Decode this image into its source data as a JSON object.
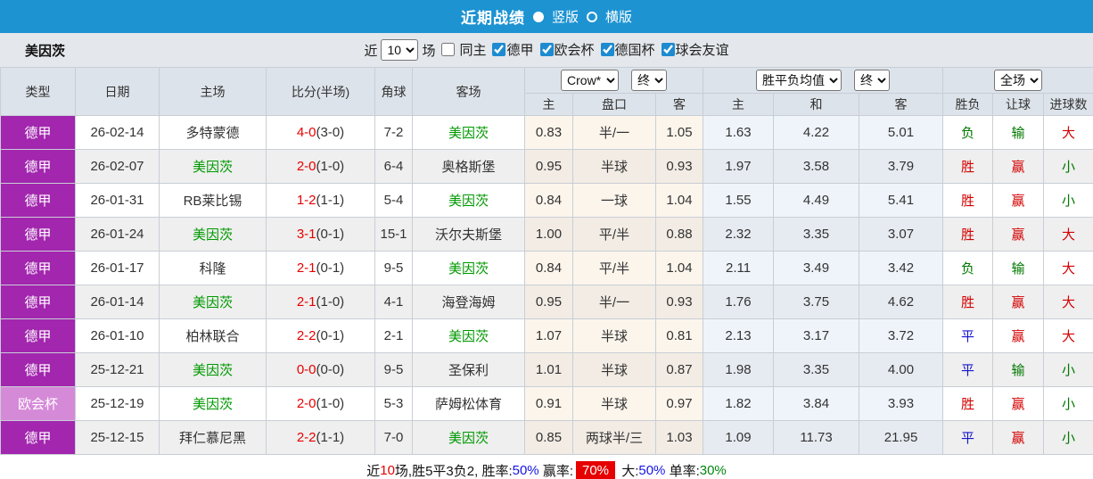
{
  "top_bar": {
    "title": "近期战绩",
    "layout_options": [
      {
        "label": "竖版",
        "selected": true
      },
      {
        "label": "横版",
        "selected": false
      }
    ]
  },
  "filter_bar": {
    "team": "美因茨",
    "recent_prefix": "近",
    "recent_count": "10",
    "recent_suffix": "场",
    "checkboxes": [
      {
        "label": "同主",
        "checked": false
      },
      {
        "label": "德甲",
        "checked": true
      },
      {
        "label": "欧会杯",
        "checked": true
      },
      {
        "label": "德国杯",
        "checked": true
      },
      {
        "label": "球会友谊",
        "checked": true
      }
    ]
  },
  "colors": {
    "topbar_blue": "#1d93d2",
    "league_purple": "#a226ae",
    "cup_purple": "#d58ad8",
    "focus_team_green": "#009900",
    "score_red": "#e80000",
    "win_red": "#d40000",
    "lose_green": "#007700",
    "draw_blue": "#1515cc"
  },
  "table": {
    "headers": {
      "type": "类型",
      "date": "日期",
      "home": "主场",
      "score": "比分(半场)",
      "corner": "角球",
      "away": "客场",
      "odds_sub": [
        "主",
        "盘口",
        "客"
      ],
      "avg_sub": [
        "主",
        "和",
        "客"
      ],
      "result_sub": [
        "胜负",
        "让球",
        "进球数"
      ]
    },
    "selects": {
      "bookmaker": "Crow*",
      "odds_time": "终",
      "avg_label": "胜平负均值",
      "avg_time": "终",
      "scope": "全场"
    },
    "rows": [
      {
        "type": {
          "label": "德甲",
          "variant": "dark"
        },
        "date": "26-02-14",
        "home": {
          "name": "多特蒙德",
          "focus": false
        },
        "score": {
          "full": "4-0",
          "half": "(3-0)"
        },
        "corner": "7-2",
        "away": {
          "name": "美因茨",
          "focus": true
        },
        "odds": [
          "0.83",
          "半/一",
          "1.05"
        ],
        "avg": [
          "1.63",
          "4.22",
          "5.01"
        ],
        "outcome": [
          {
            "t": "负",
            "c": "green"
          },
          {
            "t": "输",
            "c": "green"
          },
          {
            "t": "大",
            "c": "red"
          }
        ]
      },
      {
        "type": {
          "label": "德甲",
          "variant": "dark"
        },
        "date": "26-02-07",
        "home": {
          "name": "美因茨",
          "focus": true
        },
        "score": {
          "full": "2-0",
          "half": "(1-0)"
        },
        "corner": "6-4",
        "away": {
          "name": "奥格斯堡",
          "focus": false
        },
        "odds": [
          "0.95",
          "半球",
          "0.93"
        ],
        "avg": [
          "1.97",
          "3.58",
          "3.79"
        ],
        "outcome": [
          {
            "t": "胜",
            "c": "red"
          },
          {
            "t": "赢",
            "c": "red"
          },
          {
            "t": "小",
            "c": "green"
          }
        ]
      },
      {
        "type": {
          "label": "德甲",
          "variant": "dark"
        },
        "date": "26-01-31",
        "home": {
          "name": "RB莱比锡",
          "focus": false
        },
        "score": {
          "full": "1-2",
          "half": "(1-1)"
        },
        "corner": "5-4",
        "away": {
          "name": "美因茨",
          "focus": true
        },
        "odds": [
          "0.84",
          "一球",
          "1.04"
        ],
        "avg": [
          "1.55",
          "4.49",
          "5.41"
        ],
        "outcome": [
          {
            "t": "胜",
            "c": "red"
          },
          {
            "t": "赢",
            "c": "red"
          },
          {
            "t": "小",
            "c": "green"
          }
        ]
      },
      {
        "type": {
          "label": "德甲",
          "variant": "dark"
        },
        "date": "26-01-24",
        "home": {
          "name": "美因茨",
          "focus": true
        },
        "score": {
          "full": "3-1",
          "half": "(0-1)"
        },
        "corner": "15-1",
        "away": {
          "name": "沃尔夫斯堡",
          "focus": false
        },
        "odds": [
          "1.00",
          "平/半",
          "0.88"
        ],
        "avg": [
          "2.32",
          "3.35",
          "3.07"
        ],
        "outcome": [
          {
            "t": "胜",
            "c": "red"
          },
          {
            "t": "赢",
            "c": "red"
          },
          {
            "t": "大",
            "c": "red"
          }
        ]
      },
      {
        "type": {
          "label": "德甲",
          "variant": "dark"
        },
        "date": "26-01-17",
        "home": {
          "name": "科隆",
          "focus": false
        },
        "score": {
          "full": "2-1",
          "half": "(0-1)"
        },
        "corner": "9-5",
        "away": {
          "name": "美因茨",
          "focus": true
        },
        "odds": [
          "0.84",
          "平/半",
          "1.04"
        ],
        "avg": [
          "2.11",
          "3.49",
          "3.42"
        ],
        "outcome": [
          {
            "t": "负",
            "c": "green"
          },
          {
            "t": "输",
            "c": "green"
          },
          {
            "t": "大",
            "c": "red"
          }
        ]
      },
      {
        "type": {
          "label": "德甲",
          "variant": "dark"
        },
        "date": "26-01-14",
        "home": {
          "name": "美因茨",
          "focus": true
        },
        "score": {
          "full": "2-1",
          "half": "(1-0)"
        },
        "corner": "4-1",
        "away": {
          "name": "海登海姆",
          "focus": false
        },
        "odds": [
          "0.95",
          "半/一",
          "0.93"
        ],
        "avg": [
          "1.76",
          "3.75",
          "4.62"
        ],
        "outcome": [
          {
            "t": "胜",
            "c": "red"
          },
          {
            "t": "赢",
            "c": "red"
          },
          {
            "t": "大",
            "c": "red"
          }
        ]
      },
      {
        "type": {
          "label": "德甲",
          "variant": "dark"
        },
        "date": "26-01-10",
        "home": {
          "name": "柏林联合",
          "focus": false
        },
        "score": {
          "full": "2-2",
          "half": "(0-1)"
        },
        "corner": "2-1",
        "away": {
          "name": "美因茨",
          "focus": true
        },
        "odds": [
          "1.07",
          "半球",
          "0.81"
        ],
        "avg": [
          "2.13",
          "3.17",
          "3.72"
        ],
        "outcome": [
          {
            "t": "平",
            "c": "blue"
          },
          {
            "t": "赢",
            "c": "red"
          },
          {
            "t": "大",
            "c": "red"
          }
        ]
      },
      {
        "type": {
          "label": "德甲",
          "variant": "dark"
        },
        "date": "25-12-21",
        "home": {
          "name": "美因茨",
          "focus": true
        },
        "score": {
          "full": "0-0",
          "half": "(0-0)"
        },
        "corner": "9-5",
        "away": {
          "name": "圣保利",
          "focus": false
        },
        "odds": [
          "1.01",
          "半球",
          "0.87"
        ],
        "avg": [
          "1.98",
          "3.35",
          "4.00"
        ],
        "outcome": [
          {
            "t": "平",
            "c": "blue"
          },
          {
            "t": "输",
            "c": "green"
          },
          {
            "t": "小",
            "c": "green"
          }
        ]
      },
      {
        "type": {
          "label": "欧会杯",
          "variant": "light"
        },
        "date": "25-12-19",
        "home": {
          "name": "美因茨",
          "focus": true
        },
        "score": {
          "full": "2-0",
          "half": "(1-0)"
        },
        "corner": "5-3",
        "away": {
          "name": "萨姆松体育",
          "focus": false
        },
        "odds": [
          "0.91",
          "半球",
          "0.97"
        ],
        "avg": [
          "1.82",
          "3.84",
          "3.93"
        ],
        "outcome": [
          {
            "t": "胜",
            "c": "red"
          },
          {
            "t": "赢",
            "c": "red"
          },
          {
            "t": "小",
            "c": "green"
          }
        ]
      },
      {
        "type": {
          "label": "德甲",
          "variant": "dark"
        },
        "date": "25-12-15",
        "home": {
          "name": "拜仁慕尼黑",
          "focus": false
        },
        "score": {
          "full": "2-2",
          "half": "(1-1)"
        },
        "corner": "7-0",
        "away": {
          "name": "美因茨",
          "focus": true
        },
        "odds": [
          "0.85",
          "两球半/三",
          "1.03"
        ],
        "avg": [
          "1.09",
          "11.73",
          "21.95"
        ],
        "outcome": [
          {
            "t": "平",
            "c": "blue"
          },
          {
            "t": "赢",
            "c": "red"
          },
          {
            "t": "小",
            "c": "green"
          }
        ]
      }
    ]
  },
  "footer": {
    "segments": [
      {
        "text": "近",
        "style": "plain"
      },
      {
        "text": "10",
        "style": "red"
      },
      {
        "text": "场,胜5平3负2, 胜率:",
        "style": "plain"
      },
      {
        "text": "50%",
        "style": "blue"
      },
      {
        "text": " 赢率:",
        "style": "plain"
      },
      {
        "text": "70%",
        "style": "red-badge"
      },
      {
        "text": " 大:",
        "style": "plain"
      },
      {
        "text": "50%",
        "style": "blue"
      },
      {
        "text": " 单率:",
        "style": "plain"
      },
      {
        "text": "30%",
        "style": "green"
      }
    ]
  }
}
